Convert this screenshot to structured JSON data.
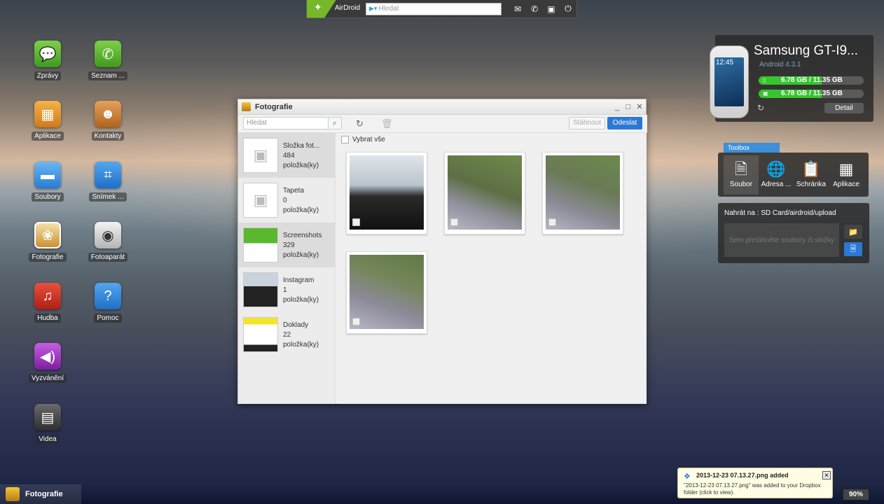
{
  "topbar": {
    "brand": "AirDroid",
    "search_placeholder": "Hledat"
  },
  "desktop": {
    "icons": [
      {
        "label": "Zprávy",
        "color": "#5cb82c"
      },
      {
        "label": "Seznam ...",
        "color": "#5cb82c"
      },
      {
        "label": "Aplikace",
        "color": "#e89a2b"
      },
      {
        "label": "Kontakty",
        "color": "#c9772a"
      },
      {
        "label": "Soubory",
        "color": "#3d93e2"
      },
      {
        "label": "Snímek ...",
        "color": "#2f86d8"
      },
      {
        "label": "Fotografie",
        "color": "#c9902a"
      },
      {
        "label": "Fotoaparát",
        "color": "#9a9a9a"
      },
      {
        "label": "Hudba",
        "color": "#d0382a"
      },
      {
        "label": "Pomoc",
        "color": "#2f86d8"
      },
      {
        "label": "Vyzvánění",
        "color": "#a63ac9"
      },
      {
        "label": "Videa",
        "color": "#4a4a4a"
      }
    ]
  },
  "device": {
    "name": "Samsung GT-I9...",
    "os": "Android 4.3.1",
    "clock": "12:45",
    "storage": [
      {
        "text": "6.78 GB / 11.35 GB",
        "fraction": 0.6
      },
      {
        "text": "6.78 GB / 11.35 GB",
        "fraction": 0.6
      }
    ],
    "detail_label": "Detail"
  },
  "toolbox": {
    "tab_label": "Toolbox",
    "tools": [
      {
        "label": "Soubor"
      },
      {
        "label": "Adresa ..."
      },
      {
        "label": "Schránka"
      },
      {
        "label": "Aplikace"
      }
    ],
    "upload_title": "Nahrát na : SD Card/airdroid/upload",
    "drop_hint": "Sem přetáhněte soubory či složky"
  },
  "window": {
    "title": "Fotografie",
    "search_placeholder": "Hledat",
    "download_label": "Stáhnout",
    "send_label": "Odeslat",
    "select_all_label": "Vybrat vše",
    "albums": [
      {
        "name": "Složka fot...",
        "count": "484",
        "unit": "položka(ky)"
      },
      {
        "name": "Tapeta",
        "count": "0",
        "unit": "položka(ky)"
      },
      {
        "name": "Screenshots",
        "count": "329",
        "unit": "položka(ky)"
      },
      {
        "name": "Instagram",
        "count": "1",
        "unit": "položka(ky)"
      },
      {
        "name": "Doklady",
        "count": "22",
        "unit": "položka(ky)"
      }
    ]
  },
  "taskbar": {
    "task_label": "Fotografie",
    "zoom": "90%"
  },
  "notification": {
    "title": "2013-12-23 07.13.27.png added",
    "body": "\"2013-12-23 07.13.27.png\" was added to your Dropbox folder (click to view)."
  }
}
